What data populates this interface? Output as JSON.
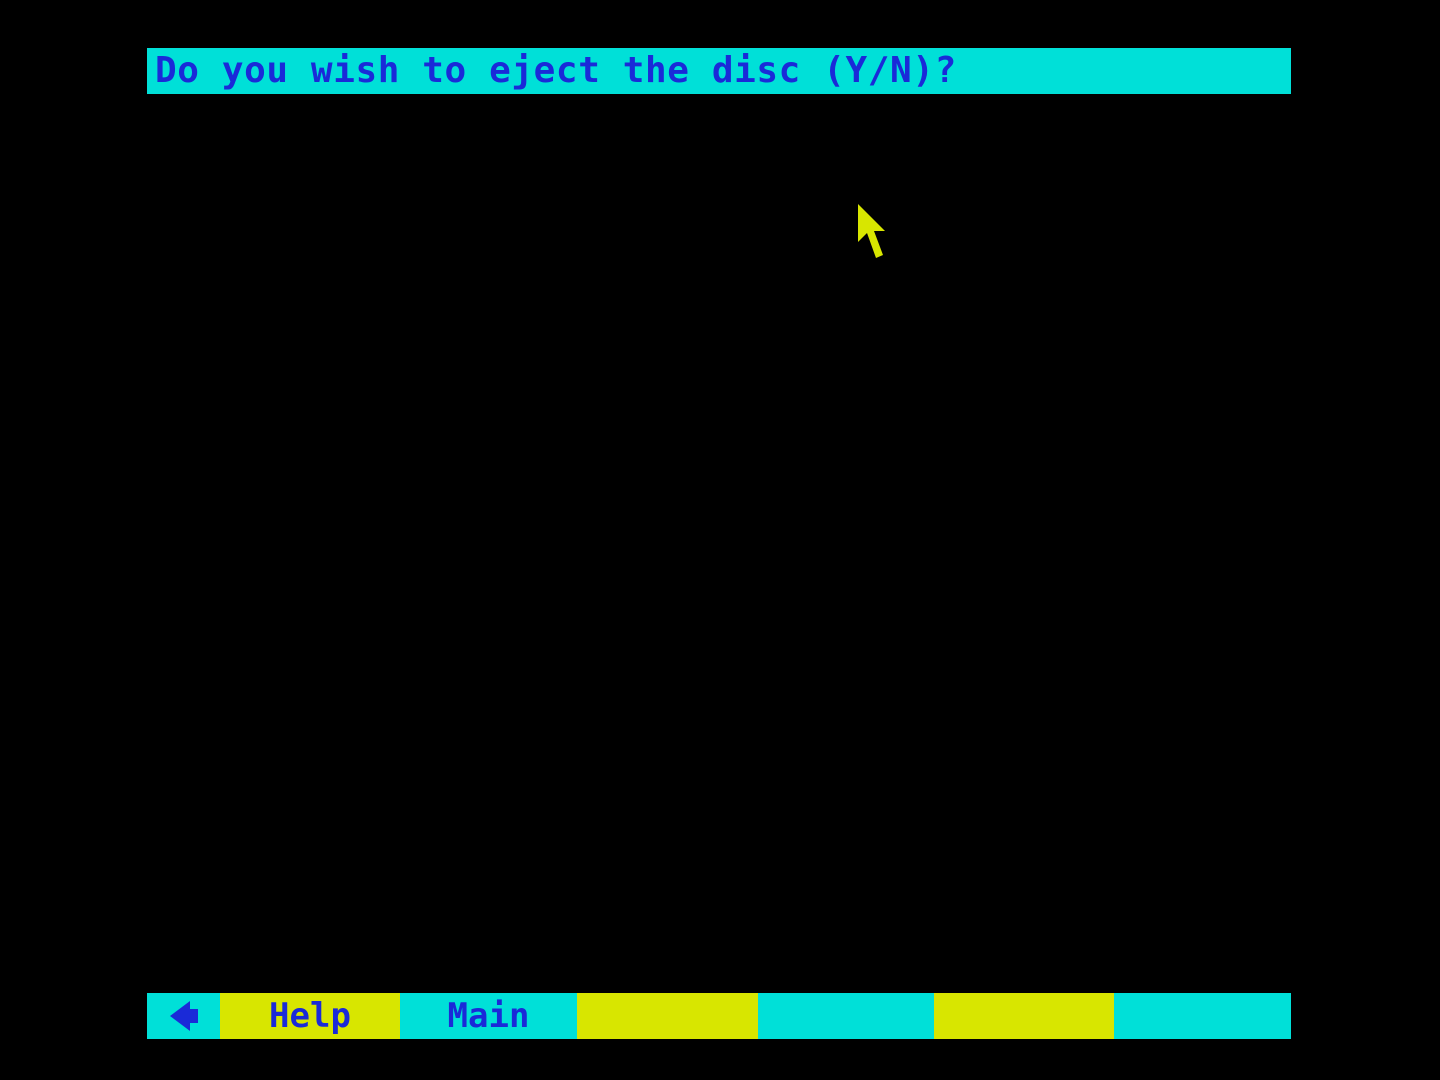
{
  "prompt": {
    "text": "Do you wish to eject the disc (Y/N)?"
  },
  "function_bar": {
    "back_icon": "left-arrow-icon",
    "keys": [
      {
        "label": "Help"
      },
      {
        "label": "Main"
      },
      {
        "label": ""
      },
      {
        "label": ""
      },
      {
        "label": ""
      },
      {
        "label": ""
      }
    ]
  },
  "colors": {
    "background": "#000000",
    "cyan": "#00e0d8",
    "yellow": "#d8e600",
    "text_blue": "#1a2ad8",
    "cursor_yellow": "#d8e600"
  },
  "cursor_icon": "mouse-pointer-icon"
}
